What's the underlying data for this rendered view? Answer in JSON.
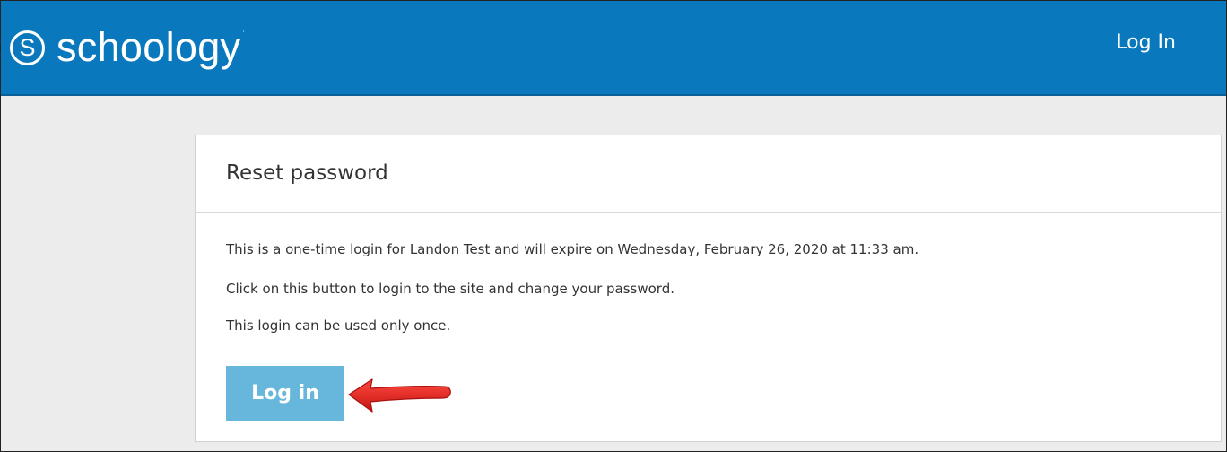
{
  "header": {
    "logo_glyph": "S",
    "logo_text": "schoology",
    "logo_tm": "·",
    "login_link": "Log In",
    "background_color": "#0a78bd"
  },
  "card": {
    "title": "Reset password",
    "messages": [
      "This is a one-time login for Landon Test and will expire on Wednesday, February 26, 2020 at 11:33 am.",
      "Click on this button to login to the site and change your password.",
      "This login can be used only once."
    ],
    "login_button": "Log in",
    "button_color": "#67b6db"
  },
  "annotation": {
    "icon": "red-arrow-icon",
    "color": "#e8201e"
  }
}
